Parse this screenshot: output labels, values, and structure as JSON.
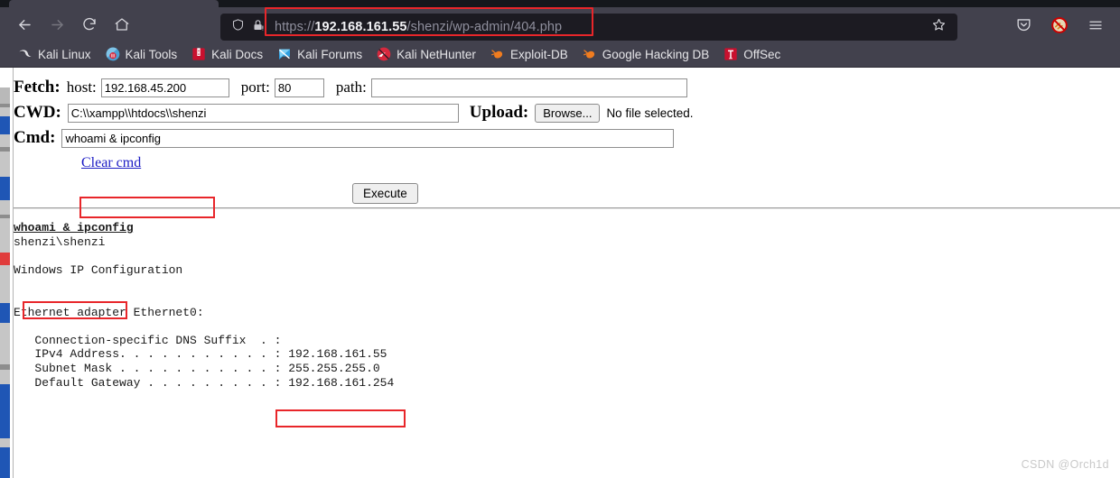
{
  "browser": {
    "nav": {
      "back_label": "Back",
      "forward_label": "Forward",
      "reload_label": "Reload",
      "home_label": "Home"
    },
    "urlbar": {
      "scheme": "https://",
      "host": "192.168.161.55",
      "path": "/shenzi/wp-admin/404.php",
      "full_url": "https://192.168.161.55/shenzi/wp-admin/404.php",
      "shield_label": "Tracking protection",
      "lock_label": "Connection not secure",
      "bookmark_star_label": "Bookmark this page"
    },
    "toolbar_right": {
      "pocket_label": "Save to Pocket",
      "blocker_label": "Script blocker",
      "menu_label": "Open application menu"
    },
    "bookmarks": [
      {
        "label": "Kali Linux",
        "icon": "kali-dragon-icon"
      },
      {
        "label": "Kali Tools",
        "icon": "kali-tools-icon"
      },
      {
        "label": "Kali Docs",
        "icon": "kali-docs-icon"
      },
      {
        "label": "Kali Forums",
        "icon": "kali-forums-icon"
      },
      {
        "label": "Kali NetHunter",
        "icon": "kali-nethunter-icon"
      },
      {
        "label": "Exploit-DB",
        "icon": "exploit-db-icon"
      },
      {
        "label": "Google Hacking DB",
        "icon": "google-hacking-db-icon"
      },
      {
        "label": "OffSec",
        "icon": "offsec-icon"
      }
    ]
  },
  "page": {
    "fetch": {
      "label": "Fetch:",
      "host_label": "host:",
      "host_value": "192.168.45.200",
      "port_label": "port:",
      "port_value": "80",
      "path_label": "path:",
      "path_value": ""
    },
    "cwd": {
      "label": "CWD:",
      "value": "C:\\\\xampp\\\\htdocs\\\\shenzi"
    },
    "upload": {
      "label": "Upload:",
      "browse_label": "Browse...",
      "status": "No file selected."
    },
    "cmd": {
      "label": "Cmd:",
      "value": "whoami & ipconfig",
      "clear_link": "Clear cmd"
    },
    "execute_label": "Execute",
    "output": {
      "command_echo": "whoami & ipconfig",
      "lines": "shenzi\\shenzi\n\nWindows IP Configuration\n\n\nEthernet adapter Ethernet0:\n\n   Connection-specific DNS Suffix  . :\n   IPv4 Address. . . . . . . . . . . : 192.168.161.55\n   Subnet Mask . . . . . . . . . . . : 255.255.255.0\n   Default Gateway . . . . . . . . . : 192.168.161.254"
    }
  },
  "annotations": {
    "highlight_color": "#e8262a",
    "boxes": [
      {
        "name": "url-highlight",
        "target": "https://192.168.161.55"
      },
      {
        "name": "cmd-highlight",
        "target": "whoami & ipconfig"
      },
      {
        "name": "user-highlight",
        "target": "shenzi\\shenzi"
      },
      {
        "name": "ipv4-highlight",
        "target": "192.168.161.55"
      }
    ]
  },
  "watermark": "CSDN @Orch1d"
}
